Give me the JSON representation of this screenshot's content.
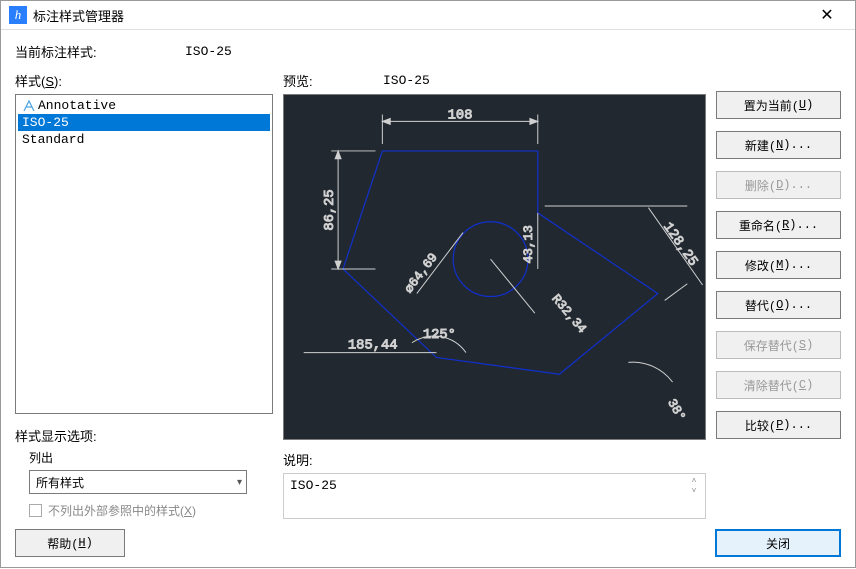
{
  "titlebar": {
    "title": "标注样式管理器"
  },
  "current": {
    "label": "当前标注样式:",
    "value": "ISO-25"
  },
  "styles_header": "样式(S):",
  "styles": [
    {
      "name": "Annotative",
      "annotative": true,
      "selected": false
    },
    {
      "name": "ISO-25",
      "annotative": false,
      "selected": true
    },
    {
      "name": "Standard",
      "annotative": false,
      "selected": false
    }
  ],
  "display_opts": {
    "header": "样式显示选项:",
    "list_label": "列出",
    "combo_value": "所有样式",
    "checkbox_label": "不列出外部参照中的样式(X)"
  },
  "preview": {
    "label": "预览:",
    "name": "ISO-25",
    "dims": {
      "top": "108",
      "left": "86,25",
      "diag": "128,25",
      "vert_small": "43,13",
      "radius": "R32,34",
      "diameter": "⌀64,69",
      "angle": "125°",
      "rot_angle": "38°",
      "bottom": "185,44"
    }
  },
  "desc": {
    "label": "说明:",
    "value": "ISO-25"
  },
  "buttons": {
    "set_current": "置为当前(U)",
    "new": "新建(N)...",
    "delete": "删除(D)...",
    "rename": "重命名(R)...",
    "modify": "修改(M)...",
    "override": "替代(O)...",
    "save_override": "保存替代(S)",
    "clear_override": "清除替代(C)",
    "compare": "比较(P)..."
  },
  "footer": {
    "help": "帮助(H)",
    "close": "关闭"
  }
}
